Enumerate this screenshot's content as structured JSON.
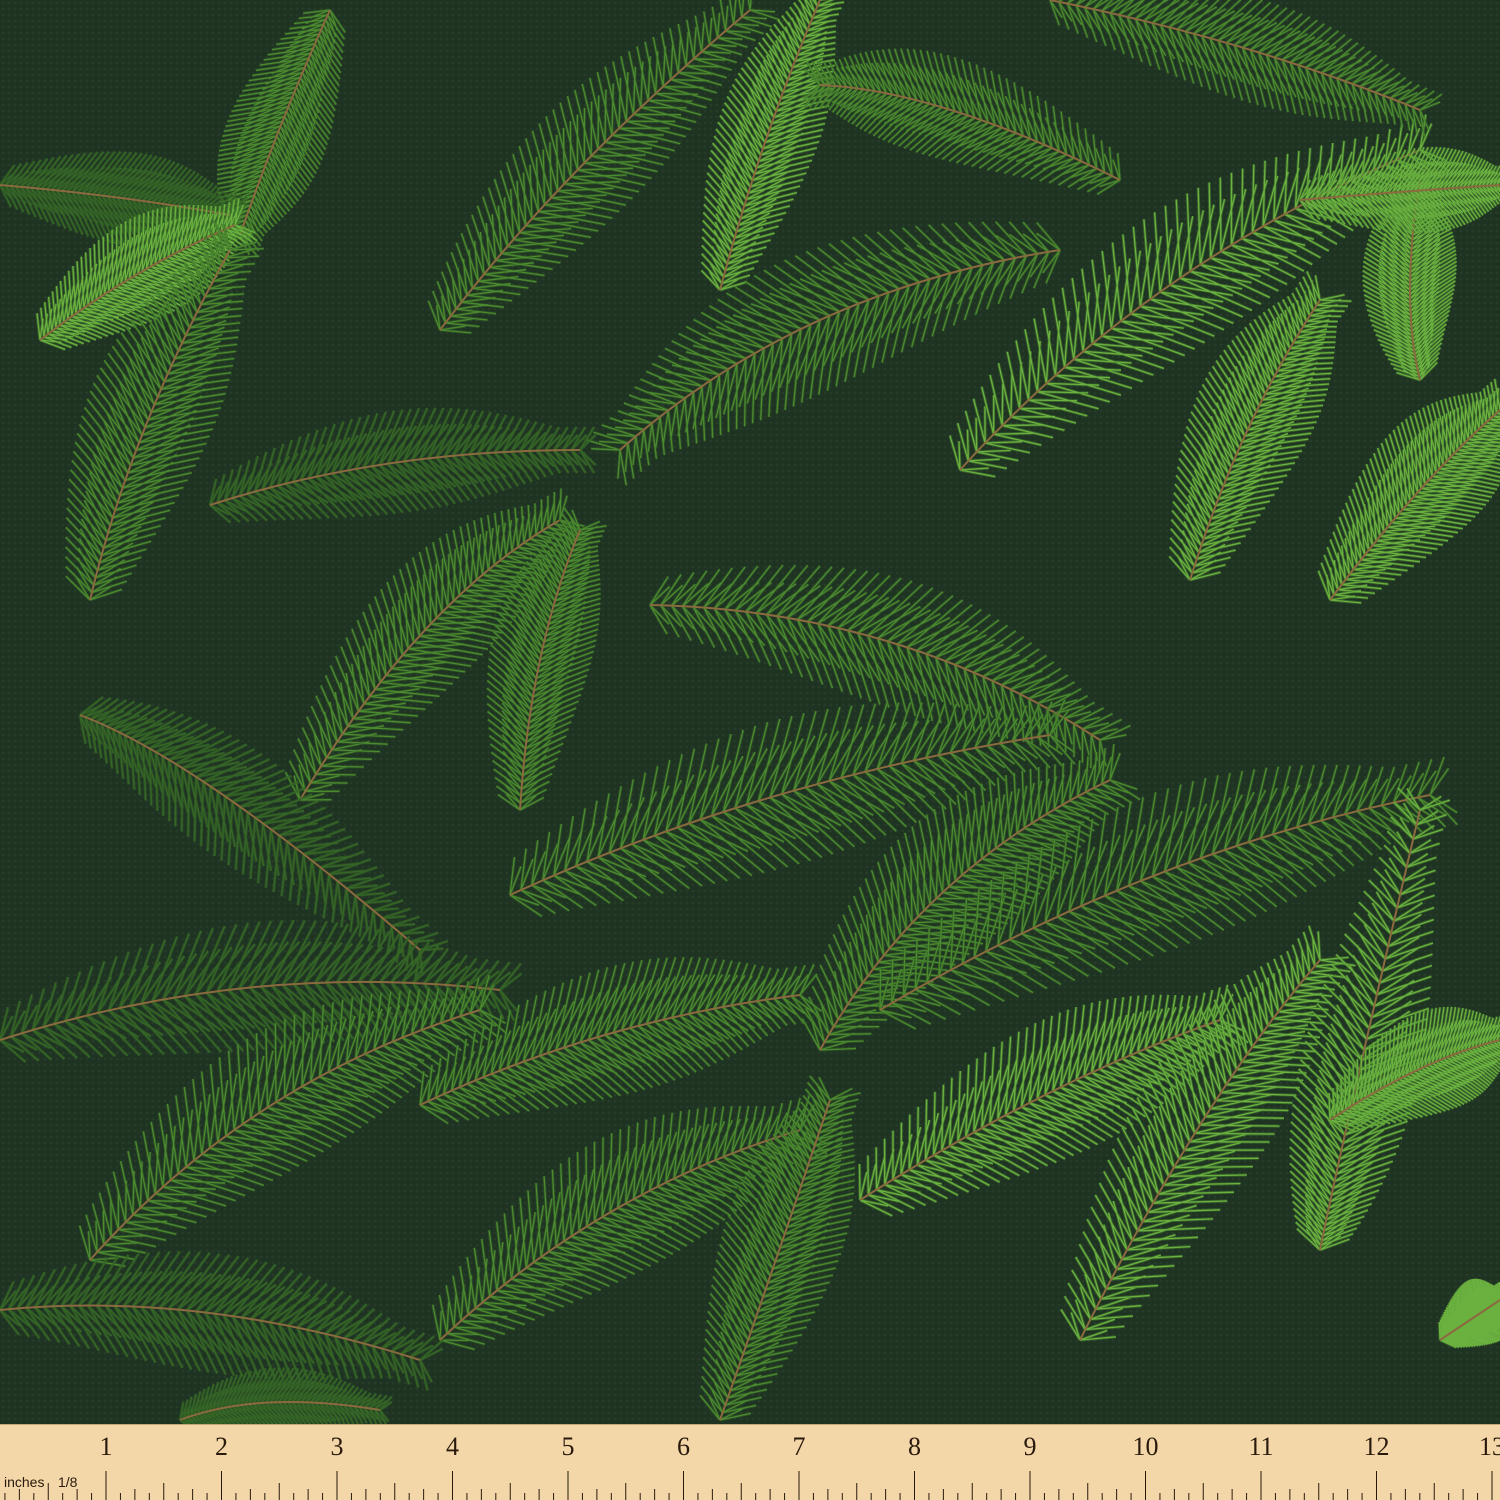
{
  "ruler": {
    "unit_label": "inches",
    "fraction_label": "1/8",
    "numbers": [
      "1",
      "2",
      "3",
      "4",
      "5",
      "6",
      "7",
      "8",
      "9",
      "10",
      "11",
      "12",
      "13"
    ]
  },
  "colors": {
    "background": "#1f3322",
    "needle_light": "#6bb140",
    "needle_mid": "#4c8a30",
    "needle_dark": "#356626",
    "stem": "#8a6a3e",
    "ruler": "#f3d7a8"
  }
}
